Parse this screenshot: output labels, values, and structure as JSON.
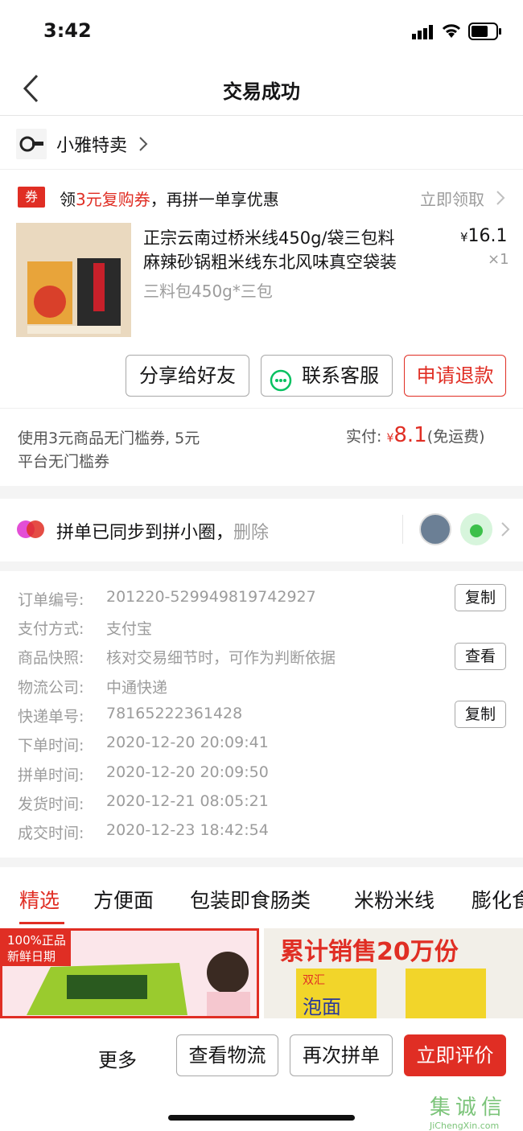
{
  "status": {
    "time": "3:42"
  },
  "nav": {
    "title": "交易成功"
  },
  "shop": {
    "name": "小雅特卖"
  },
  "coupon": {
    "tag": "券",
    "prefix": "领",
    "amount": "3元复购券",
    "suffix": "，再拼一单享优惠",
    "action": "立即领取"
  },
  "product": {
    "title_line1": "正宗云南过桥米线450g/袋三包料",
    "title_line2": "麻辣砂锅粗米线东北风味真空袋装",
    "spec": "三料包450g*三包",
    "currency": "¥",
    "price": "16.1",
    "qty": "×1"
  },
  "actions": {
    "share": "分享给好友",
    "service": "联系客服",
    "refund": "申请退款"
  },
  "payment": {
    "note_line1": "使用3元商品无门槛券, 5元",
    "note_line2": "平台无门槛券",
    "paid_label": "实付:",
    "currency": "¥",
    "paid_value": "8.1",
    "shipping": "(免运费)"
  },
  "circle": {
    "text": "拼单已同步到拼小圈，",
    "delete": "删除"
  },
  "order": {
    "rows": [
      {
        "label": "订单编号:",
        "value": "201220-529949819742927",
        "button": "复制"
      },
      {
        "label": "支付方式:",
        "value": "支付宝",
        "button": ""
      },
      {
        "label": "商品快照:",
        "value": "核对交易细节时，可作为判断依据",
        "button": "查看"
      },
      {
        "label": "物流公司:",
        "value": "中通快递",
        "button": ""
      },
      {
        "label": "快递单号:",
        "value": "78165222361428",
        "button": "复制"
      },
      {
        "label": "下单时间:",
        "value": "2020-12-20 20:09:41",
        "button": ""
      },
      {
        "label": "拼单时间:",
        "value": "2020-12-20 20:09:50",
        "button": ""
      },
      {
        "label": "发货时间:",
        "value": "2020-12-21 08:05:21",
        "button": ""
      },
      {
        "label": "成交时间:",
        "value": "2020-12-23 18:42:54",
        "button": ""
      }
    ]
  },
  "tabs": [
    "精选",
    "方便面",
    "包装即食肠类",
    "米粉米线",
    "膨化食"
  ],
  "banners": {
    "left_badge_1": "100%正品",
    "left_badge_2": "新鲜日期",
    "right_headline": "累计销售20万份",
    "right_brand": "双汇",
    "right_product": "泡面"
  },
  "bottom": {
    "more": "更多",
    "logistics": "查看物流",
    "regroup": "再次拼单",
    "review": "立即评价"
  },
  "watermark": {
    "cn": "集诚信",
    "en": "JiChengXin.com"
  },
  "colors": {
    "accent": "#e02e24",
    "green": "#07c160"
  }
}
